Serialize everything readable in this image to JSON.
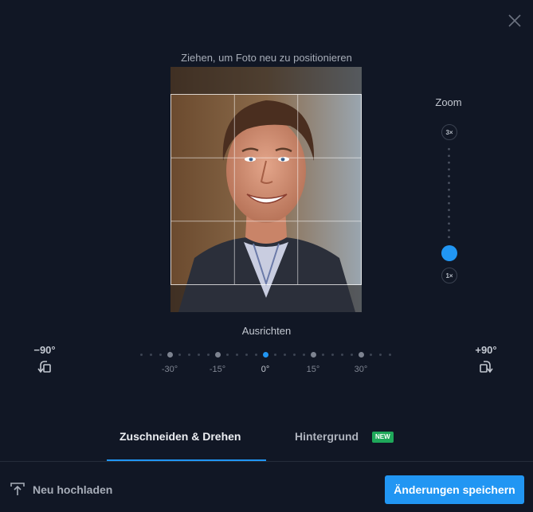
{
  "dialog": {
    "close_icon": "close-icon"
  },
  "editor": {
    "drag_hint": "Ziehen, um Foto neu zu positionieren"
  },
  "zoom": {
    "label": "Zoom",
    "max_label": "3×",
    "min_label": "1×",
    "level": 1
  },
  "straighten": {
    "label": "Ausrichten",
    "rotate_left_label": "−90°",
    "rotate_right_label": "+90°",
    "rotate_left_icon": "rotate-left-icon",
    "rotate_right_icon": "rotate-right-icon",
    "ticks": [
      "-30°",
      "-15°",
      "0°",
      "15°",
      "30°"
    ],
    "value": "0°"
  },
  "tabs": [
    {
      "label": "Zuschneiden & Drehen",
      "active": true
    },
    {
      "label": "Hintergrund",
      "active": false,
      "badge": "NEW"
    }
  ],
  "footer": {
    "upload_label": "Neu hochladen",
    "upload_icon": "upload-icon",
    "save_label": "Änderungen speichern"
  },
  "colors": {
    "background": "#111725",
    "accent": "#2196f3",
    "badge": "#1fa85a"
  }
}
